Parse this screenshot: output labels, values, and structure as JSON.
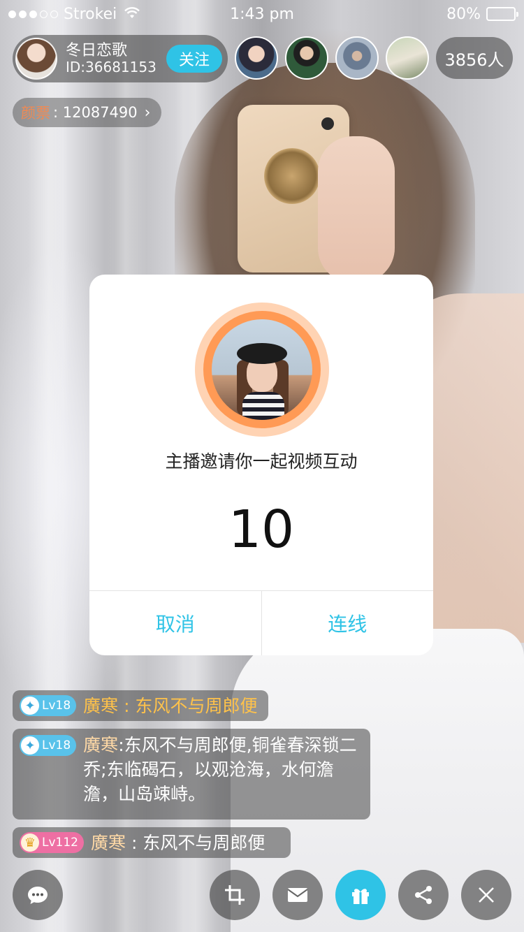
{
  "status_bar": {
    "carrier": "Strokei",
    "time": "1:43 pm",
    "battery": "80%",
    "battery_level": 0.8
  },
  "host": {
    "name": "冬日恋歌",
    "id": "ID:36681153",
    "follow_label": "关注"
  },
  "viewers": {
    "count_label": "3856人"
  },
  "coins": {
    "label": "颜票",
    "value": ": 12087490",
    "arrow": "›"
  },
  "dialog": {
    "message": "主播邀请你一起视频互动",
    "countdown": "10",
    "cancel_label": "取消",
    "confirm_label": "连线"
  },
  "chat": [
    {
      "level": "Lv18",
      "sender": "廣寒",
      "text": "廣寒 : 东风不与周郎便"
    },
    {
      "level": "Lv18",
      "sender": "廣寒",
      "text": "东风不与周郎便,铜雀春深锁二乔;东临碣石，以观沧海，水何澹澹，山岛竦峙。"
    },
    {
      "level": "Lv112",
      "sender": "廣寒",
      "text": " : 东风不与周郎便"
    }
  ],
  "toolbar": {
    "icons": [
      "chat-icon",
      "crop-icon",
      "mail-icon",
      "gift-icon",
      "share-icon",
      "close-icon"
    ]
  },
  "colors": {
    "accent": "#2fc3e6",
    "avatar_ring_outer": "#ffd3b3",
    "avatar_ring_inner": "#ff9a55",
    "coins_label": "#ef8a54",
    "chat_highlight": "#ffc24a"
  }
}
